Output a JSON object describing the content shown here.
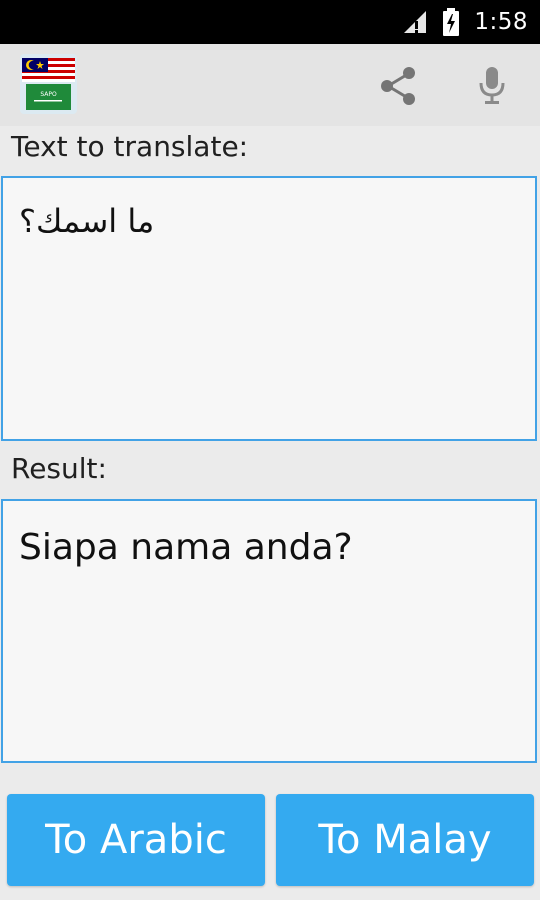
{
  "status_bar": {
    "time": "1:58",
    "icons": [
      "signal-icon",
      "battery-charging-icon"
    ]
  },
  "app_bar": {
    "logo_caption": "SAPO",
    "icons": [
      "share-icon",
      "microphone-icon"
    ]
  },
  "input": {
    "label": "Text to translate:",
    "value": "ما اسمك؟"
  },
  "result": {
    "label": "Result:",
    "value": "Siapa nama anda?"
  },
  "buttons": {
    "to_arabic": "To Arabic",
    "to_malay": "To Malay"
  },
  "colors": {
    "accent": "#34aaf0",
    "border": "#42a2e6",
    "status_bar": "#000000",
    "app_bar": "#e4e4e4"
  }
}
